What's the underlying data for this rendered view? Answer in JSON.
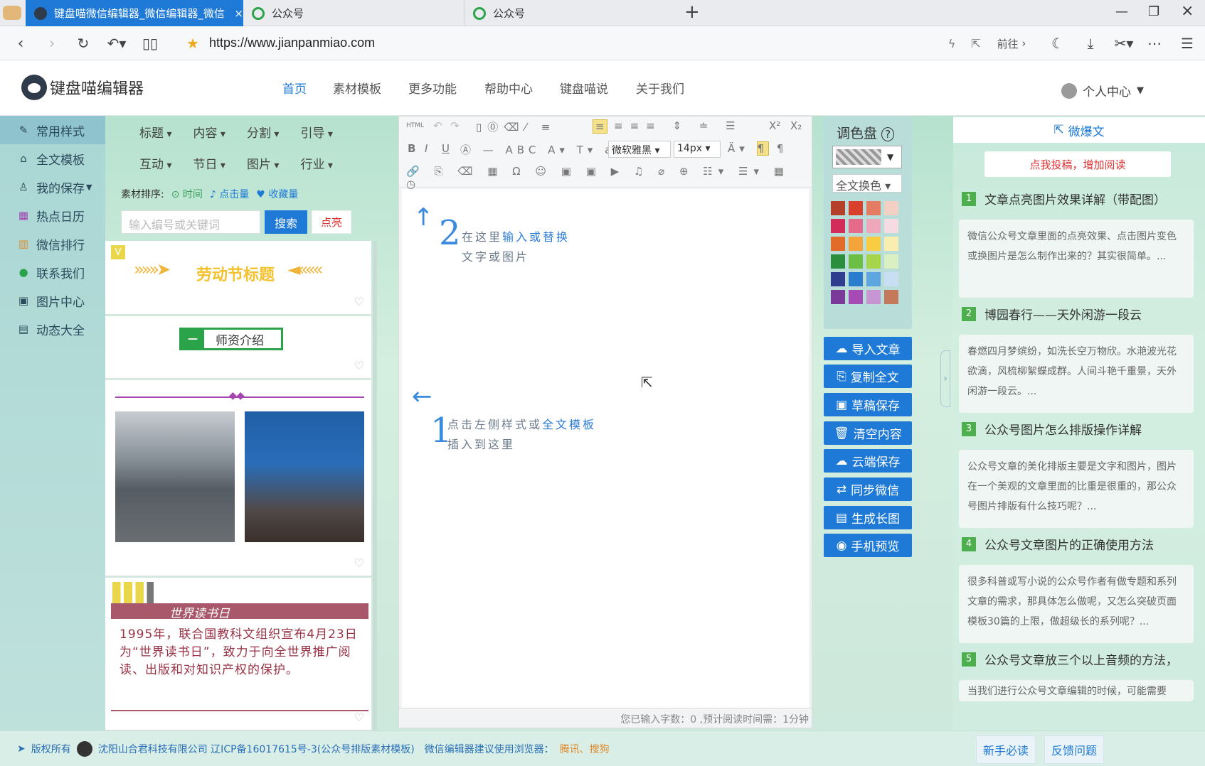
{
  "browser": {
    "tabs": [
      {
        "label": "键盘喵微信编辑器_微信编辑器_微信"
      },
      {
        "label": "公众号"
      },
      {
        "label": "公众号"
      }
    ],
    "url": "https://www.jianpanmiao.com",
    "goto_label": "前往"
  },
  "site": {
    "logo_text": "键盘喵编辑器",
    "nav": [
      "首页",
      "素材模板",
      "更多功能",
      "帮助中心",
      "键盘喵说",
      "关于我们"
    ],
    "user_center": "个人中心"
  },
  "sidebar": {
    "items": [
      {
        "label": "常用样式",
        "icon": "palette-icon"
      },
      {
        "label": "全文模板",
        "icon": "bank-icon"
      },
      {
        "label": "我的保存",
        "icon": "user-icon"
      },
      {
        "label": "热点日历",
        "icon": "calendar-icon"
      },
      {
        "label": "微信排行",
        "icon": "bar-chart-icon"
      },
      {
        "label": "联系我们",
        "icon": "wechat-icon"
      },
      {
        "label": "图片中心",
        "icon": "image-icon"
      },
      {
        "label": "动态大全",
        "icon": "doc-icon"
      }
    ]
  },
  "materials": {
    "categories_row1": [
      "标题",
      "内容",
      "分割",
      "引导"
    ],
    "categories_row2": [
      "互动",
      "节日",
      "图片",
      "行业"
    ],
    "sort_label": "素材排序:",
    "sort_options": [
      "时间",
      "点击量",
      "收藏量"
    ],
    "search_placeholder": "输入编号或关键词",
    "search_button": "搜索",
    "highlight_button": "点亮",
    "card1_title": "劳动节标题",
    "card1_badge": "V",
    "card2_minus": "—",
    "card2_title": "师资介绍",
    "card4_title": "世界读书日",
    "card4_text": "1995年，联合国教科文组织宣布4月23日为“世界读书日”，致力于向全世界推广阅读、出版和对知识产权的保护。"
  },
  "editor": {
    "font_name": "微软雅黑",
    "font_size": "14px",
    "html_label": "HTML",
    "hint2_num": "2",
    "hint2_line1_a": "在这里",
    "hint2_line1_b": "输入或替换",
    "hint2_line2": "文字或图片",
    "hint1_num": "1",
    "hint1_line1_a": "点击左侧样式或",
    "hint1_line1_b": "全文模板",
    "hint1_line2": "插入到这里",
    "status": "您已输入字数：0 ,预计阅读时间需：1分钟"
  },
  "palette": {
    "title": "调色盘",
    "replace_all": "全文换色",
    "colors": [
      "#b5402a",
      "#d8402c",
      "#e47b63",
      "#f3cfc4",
      "#d42c5a",
      "#e66a8c",
      "#eea8bb",
      "#f6dbe3",
      "#e36b2a",
      "#f4a43a",
      "#f8cd43",
      "#faedb0",
      "#2a8e3c",
      "#6cbe44",
      "#a6d44a",
      "#daf0c2",
      "#2f3d8e",
      "#2a7ccd",
      "#5ea6e0",
      "#c7def3",
      "#7a3a9a",
      "#a64ab5",
      "#c895d3",
      "#c47a5a"
    ]
  },
  "actions": [
    {
      "label": "导入文章",
      "icon": "cloud-upload-icon"
    },
    {
      "label": "复制全文",
      "icon": "copy-icon"
    },
    {
      "label": "草稿保存",
      "icon": "save-icon"
    },
    {
      "label": "清空内容",
      "icon": "trash-icon"
    },
    {
      "label": "云端保存",
      "icon": "cloud-icon"
    },
    {
      "label": "同步微信",
      "icon": "sync-icon"
    },
    {
      "label": "生成长图",
      "icon": "long-image-icon"
    },
    {
      "label": "手机预览",
      "icon": "eye-icon"
    }
  ],
  "right": {
    "tab": "微爆文",
    "promo": "点我投稿，增加阅读",
    "articles": [
      {
        "num": "1",
        "title": "文章点亮图片效果详解（带配图）",
        "excerpt": "微信公众号文章里面的点亮效果、点击图片变色或换图片是怎么制作出来的？其实很简单。..."
      },
      {
        "num": "2",
        "title": "博园春行——天外闲游一段云",
        "excerpt": "春燃四月梦缤纷，如洗长空万物欣。水滟波光花欲滴，风梳柳絮蝶成群。人间斗艳千重景，天外闲游一段云。..."
      },
      {
        "num": "3",
        "title": "公众号图片怎么排版操作详解",
        "excerpt": "公众号文章的美化排版主要是文字和图片，图片在一个美观的文章里面的比重是很重的，那公众号图片排版有什么技巧呢？..."
      },
      {
        "num": "4",
        "title": "公众号文章图片的正确使用方法",
        "excerpt": "很多科普或写小说的公众号作者有做专题和系列文章的需求，那具体怎么做呢，又怎么突破页面模板30篇的上限，做超级长的系列呢？..."
      },
      {
        "num": "5",
        "title": "公众号文章放三个以上音频的方法，",
        "excerpt": "当我们进行公众号文章编辑的时候，可能需要"
      }
    ]
  },
  "footer": {
    "copyright": "版权所有",
    "company": "沈阳山合君科技有限公司 辽ICP备16017615号-3(公众号排版素材模板)",
    "browser_tip": "微信编辑器建议使用浏览器：",
    "browsers": "腾讯、搜狗",
    "newbie": "新手必读",
    "feedback": "反馈问题"
  }
}
